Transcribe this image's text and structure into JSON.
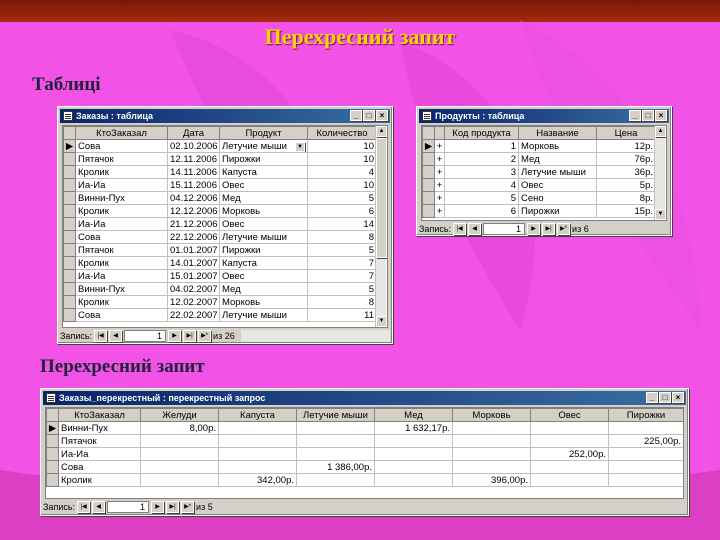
{
  "slide": {
    "title": "Перехресний запит",
    "caption_tables": "Таблиці",
    "caption_query": "Перехресний запит"
  },
  "colors": {
    "background": "#f252e6",
    "title": "#ffd200",
    "titlebar": "#0a246a"
  },
  "orders_window": {
    "title": "Заказы : таблица",
    "columns": [
      "КтоЗаказал",
      "Дата",
      "Продукт",
      "Количество"
    ],
    "rows": [
      [
        "Сова",
        "02.10.2006",
        "Летучие мыши",
        "10"
      ],
      [
        "Пятачок",
        "12.11.2006",
        "Пирожки",
        "10"
      ],
      [
        "Кролик",
        "14.11.2006",
        "Капуста",
        "4"
      ],
      [
        "Иа-Иа",
        "15.11.2006",
        "Овес",
        "10"
      ],
      [
        "Винни-Пух",
        "04.12.2006",
        "Мед",
        "5"
      ],
      [
        "Кролик",
        "12.12.2006",
        "Морковь",
        "6"
      ],
      [
        "Иа-Иа",
        "21.12.2006",
        "Овес",
        "14"
      ],
      [
        "Сова",
        "22.12.2006",
        "Летучие мыши",
        "8"
      ],
      [
        "Пятачок",
        "01.01.2007",
        "Пирожки",
        "5"
      ],
      [
        "Кролик",
        "14.01.2007",
        "Капуста",
        "7"
      ],
      [
        "Иа-Иа",
        "15.01.2007",
        "Овес",
        "7"
      ],
      [
        "Винни-Пух",
        "04.02.2007",
        "Мед",
        "5"
      ],
      [
        "Кролик",
        "12.02.2007",
        "Морковь",
        "8"
      ],
      [
        "Сова",
        "22.02.2007",
        "Летучие мыши",
        "11"
      ]
    ],
    "nav": {
      "label": "Запись:",
      "current": "1",
      "total": "из 26"
    }
  },
  "products_window": {
    "title": "Продукты : таблица",
    "columns": [
      "Код продукта",
      "Название",
      "Цена"
    ],
    "rows": [
      [
        "1",
        "Морковь",
        "12р."
      ],
      [
        "2",
        "Мед",
        "76р."
      ],
      [
        "3",
        "Летучие мыши",
        "36р."
      ],
      [
        "4",
        "Овес",
        "5р."
      ],
      [
        "5",
        "Сено",
        "8р."
      ],
      [
        "6",
        "Пирожки",
        "15р."
      ]
    ],
    "nav": {
      "label": "Запись:",
      "current": "1",
      "total": "из 6"
    }
  },
  "crosstab_window": {
    "title": "Заказы_перекрестный : перекрестный запрос",
    "columns": [
      "КтоЗаказал",
      "Желуди",
      "Капуста",
      "Летучие мыши",
      "Мед",
      "Морковь",
      "Овес",
      "Пирожки"
    ],
    "rows": [
      [
        "Винни-Пух",
        "8,00р.",
        "",
        "",
        "1 632,17р.",
        "",
        "",
        ""
      ],
      [
        "Пятачок",
        "",
        "",
        "",
        "",
        "",
        "",
        "225,00р."
      ],
      [
        "Иа-Иа",
        "",
        "",
        "",
        "",
        "",
        "252,00р.",
        ""
      ],
      [
        "Сова",
        "",
        "",
        "1 386,00р.",
        "",
        "",
        "",
        ""
      ],
      [
        "Кролик",
        "",
        "342,00р.",
        "",
        "",
        "396,00р.",
        "",
        ""
      ]
    ],
    "nav": {
      "label": "Запись:",
      "current": "1",
      "total": "из 5"
    }
  }
}
